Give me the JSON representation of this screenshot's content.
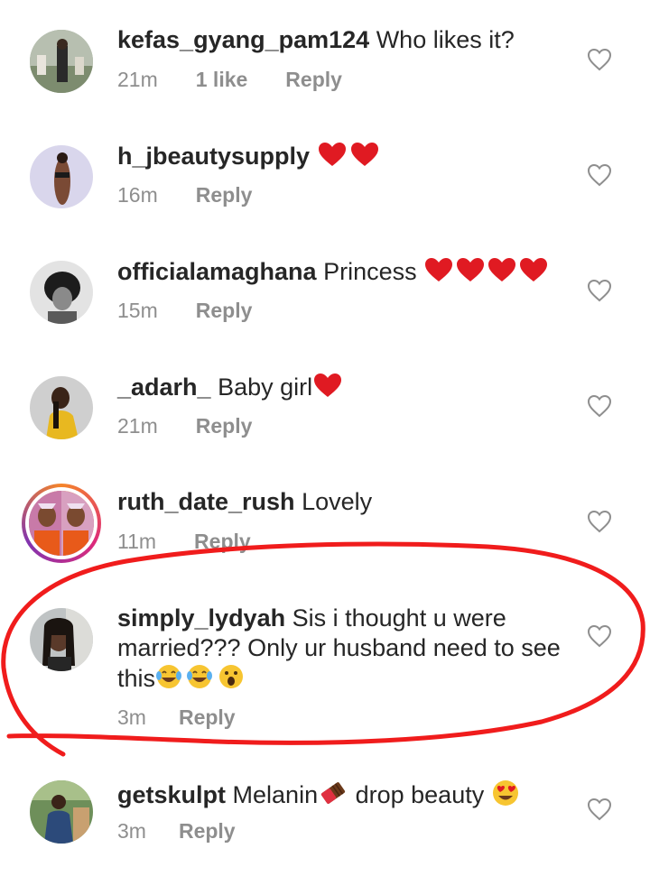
{
  "comments": [
    {
      "username": "kefas_gyang_pam124",
      "text": "Who likes it?",
      "time": "21m",
      "likes": "1 like",
      "reply": "Reply"
    },
    {
      "username": "h_jbeautysupply",
      "text": "",
      "emoji": "❤️❤️",
      "time": "16m",
      "reply": "Reply"
    },
    {
      "username": "officialamaghana",
      "text": "Princess",
      "emoji": "❤️❤️❤️❤️",
      "time": "15m",
      "reply": "Reply"
    },
    {
      "username": "_adarh_",
      "text": "Baby girl",
      "emoji": "❤️",
      "time": "21m",
      "reply": "Reply"
    },
    {
      "username": "ruth_date_rush",
      "text": "Lovely",
      "time": "11m",
      "reply": "Reply"
    },
    {
      "username": "simply_lydyah",
      "text_line1": "Sis i thought u were",
      "text_line2": "married??? Only ur husband need to see",
      "text_line3": "this",
      "emoji": "😂😂😮",
      "time": "3m",
      "reply": "Reply"
    },
    {
      "username": "getskulpt",
      "text_a": "Melanin",
      "emoji_a": "🍫",
      "text_b": "drop beauty",
      "emoji_b": "😍",
      "time": "3m",
      "reply": "Reply"
    }
  ],
  "colors": {
    "username": "#262626",
    "meta": "#8e8e8e",
    "heart_red": "#e01a22",
    "annotation_red": "#f01c1c"
  },
  "icons": {
    "like": "heart-outline-icon",
    "heart_emoji": "red-heart-emoji",
    "laugh_emoji": "tears-of-joy-emoji",
    "surprise_emoji": "open-mouth-emoji",
    "chocolate_emoji": "chocolate-bar-emoji",
    "heart_eyes_emoji": "heart-eyes-emoji"
  }
}
